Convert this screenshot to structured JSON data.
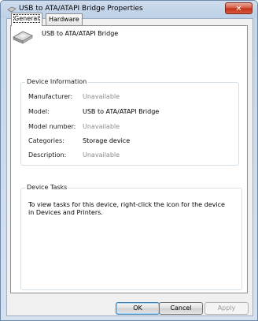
{
  "window": {
    "title": "USB to ATA/ATAPI Bridge Properties",
    "close_glyph": "✕"
  },
  "tabs": [
    {
      "label": "General",
      "active": true
    },
    {
      "label": "Hardware",
      "active": false
    }
  ],
  "device": {
    "icon": "storage-device-icon",
    "name": "USB to ATA/ATAPI Bridge"
  },
  "device_information": {
    "legend": "Device Information",
    "rows": [
      {
        "label": "Manufacturer:",
        "value": "Unavailable",
        "muted": true
      },
      {
        "label": "Model:",
        "value": "USB to ATA/ATAPI Bridge",
        "muted": false
      },
      {
        "label": "Model number:",
        "value": "Unavailable",
        "muted": true
      },
      {
        "label": "Categories:",
        "value": "Storage device",
        "muted": false
      },
      {
        "label": "Description:",
        "value": "Unavailable",
        "muted": true
      }
    ]
  },
  "device_tasks": {
    "legend": "Device Tasks",
    "text": "To view tasks for this device, right-click the icon for the device in Devices and Printers."
  },
  "buttons": {
    "ok": "OK",
    "cancel": "Cancel",
    "apply": "Apply"
  }
}
